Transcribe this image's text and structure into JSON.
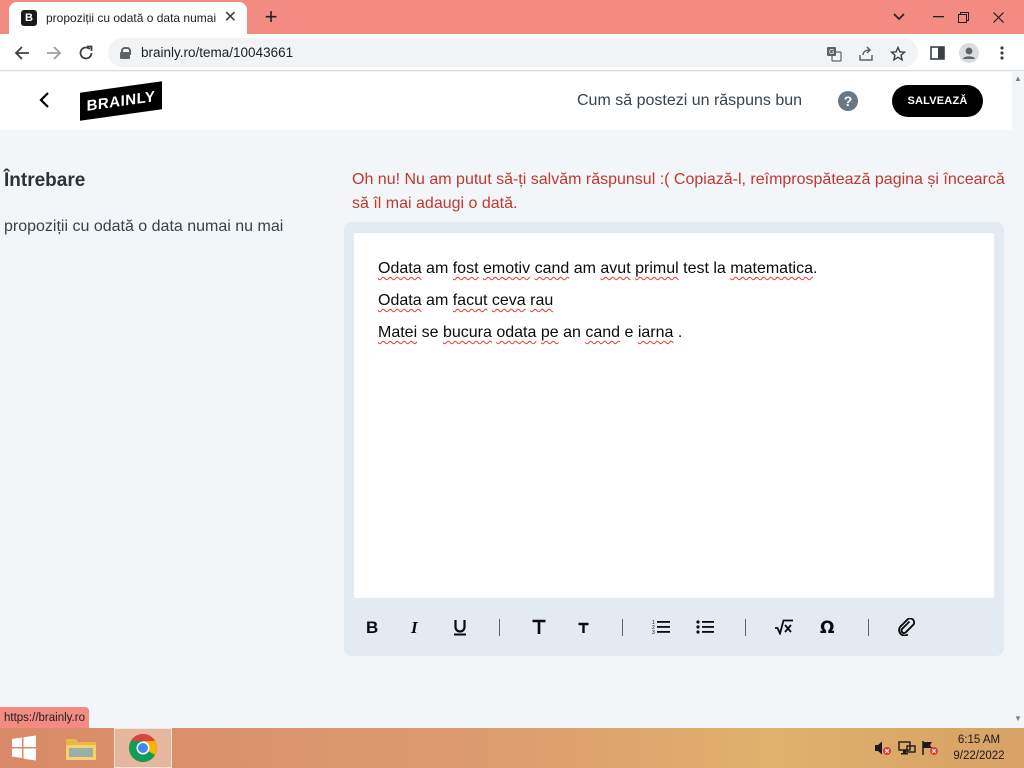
{
  "browser": {
    "tab_title": "propoziții cu odată o data numai nu mai - Brainly.ro",
    "favicon_letter": "B",
    "url": "brainly.ro/tema/10043661",
    "status_url": "https://brainly.ro"
  },
  "header": {
    "logo_text": "BRAINLY",
    "howto_link": "Cum să postezi un răspuns bun",
    "help_icon": "?",
    "save_label": "SALVEAZĂ"
  },
  "question": {
    "heading": "Întrebare",
    "text": "propoziții cu odată o data numai nu mai"
  },
  "error_message": "Oh nu! Nu am putut să-ți salvăm răspunsul :( Copiază-l, reîmprospătează pagina și încearcă să îl mai adaugi o dată.",
  "editor": {
    "lines": [
      "Odata am fost emotiv cand am avut primul test la matematica.",
      "Odata am facut ceva rau",
      "Matei se bucura odata pe an cand e iarna ."
    ],
    "toolbar_icons": [
      "bold-icon",
      "italic-icon",
      "underline-icon",
      "heading-large-icon",
      "heading-small-icon",
      "numbered-list-icon",
      "bulleted-list-icon",
      "equation-icon",
      "special-characters-icon",
      "attachment-icon"
    ]
  },
  "taskbar": {
    "time": "6:15 AM",
    "date": "9/22/2022"
  },
  "colors": {
    "chrome_frame": "#f28b82",
    "error_text": "#c0392b",
    "editor_frame": "#e3ebf2",
    "button_black": "#000000"
  }
}
